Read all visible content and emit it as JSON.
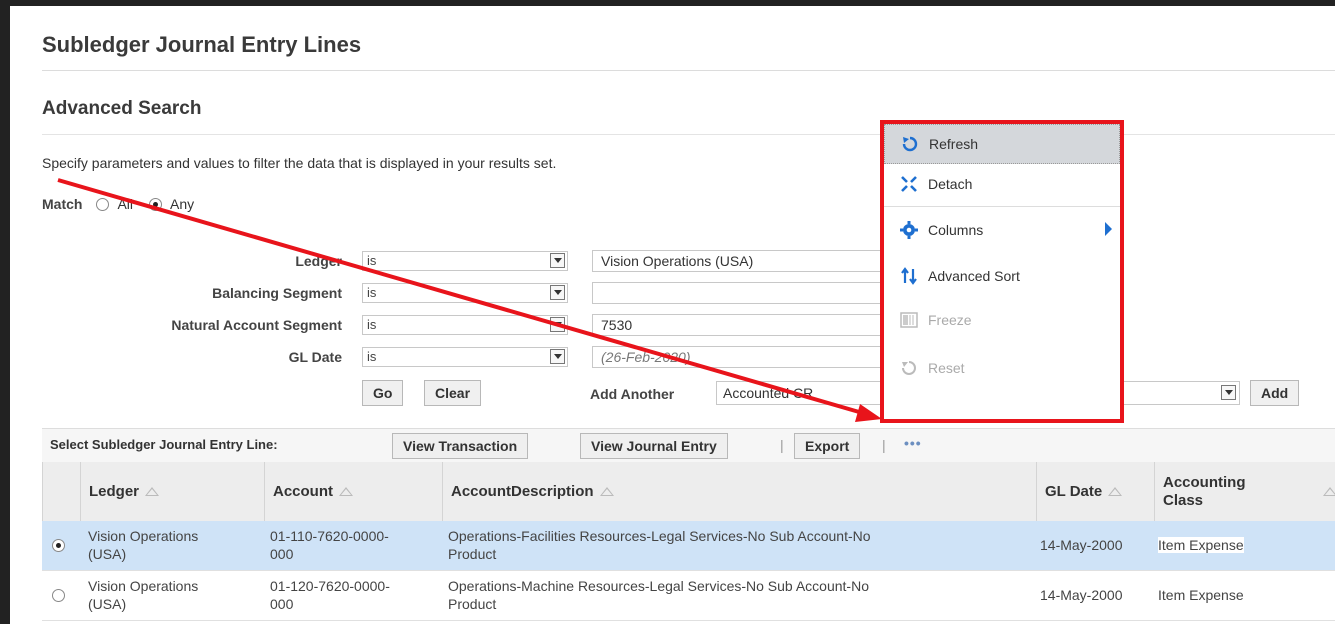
{
  "page": {
    "title": "Subledger Journal Entry Lines"
  },
  "search": {
    "title": "Advanced Search",
    "instructions": "Specify parameters and values to filter the data that is displayed in your results set.",
    "match_label": "Match",
    "match_all": "All",
    "match_any": "Any",
    "criteria": [
      {
        "label": "Ledger",
        "operator": "is",
        "value": "Vision Operations (USA)"
      },
      {
        "label": "Balancing Segment",
        "operator": "is",
        "value": ""
      },
      {
        "label": "Natural Account Segment",
        "operator": "is",
        "value": "7530"
      },
      {
        "label": "GL Date",
        "operator": "is",
        "value": "(26-Feb-2020)"
      }
    ],
    "go_label": "Go",
    "clear_label": "Clear",
    "add_another_label": "Add Another",
    "add_another_value": "Accounted CR",
    "add_label": "Add"
  },
  "toolbar": {
    "select_label": "Select Subledger Journal Entry Line:",
    "view_transaction": "View Transaction",
    "view_journal_entry": "View Journal Entry",
    "sep": "|",
    "export": "Export",
    "overflow": "•••"
  },
  "table": {
    "columns": [
      "Ledger",
      "Account",
      "AccountDescription",
      "GL Date",
      "Accounting Class"
    ],
    "rows": [
      {
        "ledger_1": "Vision Operations",
        "ledger_2": "(USA)",
        "account_1": "01-110-7620-0000-",
        "account_2": "000",
        "desc_1": "Operations-Facilities Resources-Legal Services-No Sub Account-No",
        "desc_2": "Product",
        "gl_date": "14-May-2000",
        "class": "Item Expense",
        "selected": true
      },
      {
        "ledger_1": "Vision Operations",
        "ledger_2": "(USA)",
        "account_1": "01-120-7620-0000-",
        "account_2": "000",
        "desc_1": "Operations-Machine Resources-Legal Services-No Sub Account-No",
        "desc_2": "Product",
        "gl_date": "14-May-2000",
        "class": "Item Expense",
        "selected": false
      }
    ]
  },
  "menu": {
    "items": [
      {
        "label": "Refresh",
        "icon": "refresh-icon",
        "state": "active"
      },
      {
        "label": "Detach",
        "icon": "detach-icon",
        "state": "enabled"
      },
      {
        "label": "Columns",
        "icon": "gear-icon",
        "state": "enabled"
      },
      {
        "label": "Advanced Sort",
        "icon": "sort-icon",
        "state": "enabled"
      },
      {
        "label": "Freeze",
        "icon": "freeze-icon",
        "state": "disabled"
      },
      {
        "label": "Reset",
        "icon": "reset-icon",
        "state": "disabled"
      }
    ]
  },
  "colors": {
    "highlight_border": "#e8141b",
    "annotation_arrow": "#e8141b",
    "selected_row": "#cfe3f7",
    "menu_active": "#d4d7db"
  }
}
